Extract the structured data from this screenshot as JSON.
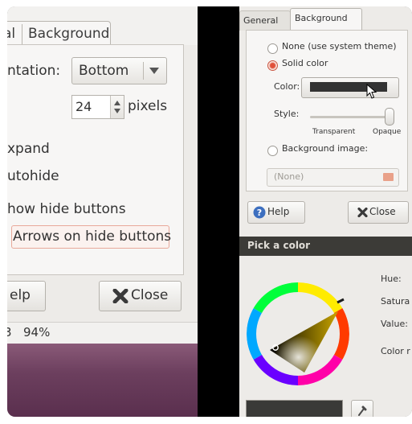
{
  "left_panel": {
    "tabs": {
      "general_partial": "al",
      "background": "Background"
    },
    "orientation": {
      "label_partial": "ntation:",
      "value": "Bottom"
    },
    "size": {
      "value": "24",
      "unit": "pixels"
    },
    "options": {
      "expand_partial": "xpand",
      "autohide_partial": "utohide",
      "show_hide_buttons_partial": "how hide buttons",
      "arrows_on_hide_buttons": "Arrows on hide buttons"
    },
    "buttons": {
      "help_partial": "elp",
      "close": "Close"
    },
    "statusbar": {
      "left_partial": "3",
      "zoom": "94%"
    }
  },
  "right_panel": {
    "tabs": {
      "general": "General",
      "background": "Background"
    },
    "background_options": {
      "none": "None (use system theme)",
      "solid": "Solid color",
      "selected": "Solid color",
      "color_label": "Color:",
      "style_label": "Style:",
      "transparent": "Transparent",
      "opaque": "Opaque",
      "style_level": 1.0,
      "image_option": "Background image:",
      "image_value": "(None)"
    },
    "buttons": {
      "help": "Help",
      "close": "Close"
    },
    "color_picker": {
      "title": "Pick a color",
      "hue_label": "Hue:",
      "saturation_label_partial": "Satura",
      "value_label": "Value:",
      "color_name_partial": "Color r",
      "current_color": "#333333"
    }
  },
  "icons": [
    "chevron-down-icon",
    "spin-arrows-icon",
    "close-x-icon",
    "help-icon",
    "folder-icon",
    "eyedropper-icon",
    "mouse-cursor-icon"
  ],
  "colors": {
    "accent": "#e0503a",
    "dialog_bg": "#edebe8",
    "titlebar": "#3c3b37",
    "desktop": "#6c3f5e",
    "selected_color": "#333333"
  }
}
